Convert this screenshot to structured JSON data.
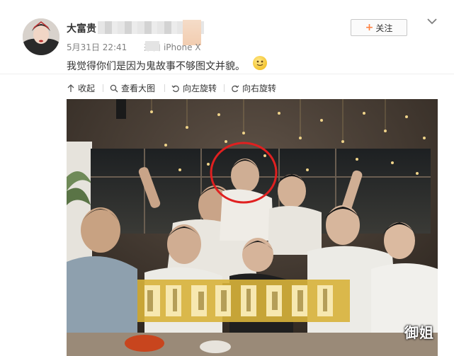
{
  "post": {
    "username": "大富贵",
    "date": "5月31日 22:41",
    "source": "来自 iPhone X",
    "text": "我觉得你们是因为鬼故事不够图文并貌。"
  },
  "follow_button": {
    "label": "关注"
  },
  "toolbar": {
    "collapse": "收起",
    "view_large": "查看大图",
    "rotate_left": "向左旋转",
    "rotate_right": "向右旋转"
  },
  "watermark": "御姐",
  "icons": [
    "avatar",
    "chevron-down-icon",
    "smile-emoji-icon",
    "collapse-icon",
    "zoom-icon",
    "rotate-left-icon",
    "rotate-right-icon"
  ],
  "colors": {
    "follow_plus": "#ff8140",
    "highlight_circle": "#e02020"
  }
}
